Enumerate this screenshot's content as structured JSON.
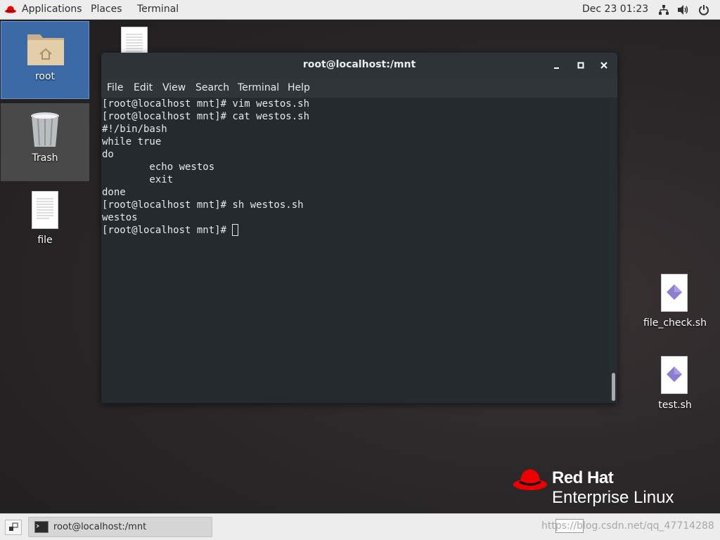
{
  "topbar": {
    "applications": "Applications",
    "places": "Places",
    "terminal": "Terminal",
    "datetime": "Dec 23  01:23",
    "icons": [
      "network-icon",
      "volume-icon",
      "power-icon"
    ]
  },
  "desktop": {
    "icons": [
      {
        "label": "root",
        "icon": "home-folder-icon"
      },
      {
        "label": "Trash",
        "icon": "trash-icon"
      },
      {
        "label": "file",
        "icon": "document-icon"
      },
      {
        "label": "file_check.sh",
        "icon": "script-icon"
      },
      {
        "label": "test.sh",
        "icon": "script-icon"
      }
    ]
  },
  "terminal": {
    "title": "root@localhost:/mnt",
    "menu": [
      "File",
      "Edit",
      "View",
      "Search",
      "Terminal",
      "Help"
    ],
    "lines": [
      "[root@localhost mnt]# vim westos.sh",
      "[root@localhost mnt]# cat westos.sh",
      "#!/bin/bash",
      "while true",
      "do",
      "        echo westos",
      "        exit",
      "done",
      "[root@localhost mnt]# sh westos.sh",
      "westos"
    ],
    "prompt": "[root@localhost mnt]# "
  },
  "branding": {
    "line1": "Red Hat",
    "line2": "Enterprise Linux",
    "accent": "#ee0000"
  },
  "taskbar": {
    "window_label": "root@localhost:/mnt",
    "watermark": "https://blog.csdn.net/qq_47714288"
  }
}
